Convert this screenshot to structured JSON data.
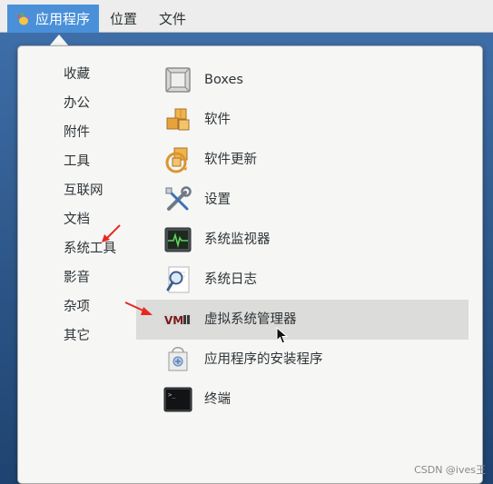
{
  "panel": {
    "applications_label": "应用程序",
    "places_label": "位置",
    "files_label": "文件"
  },
  "categories": [
    "收藏",
    "办公",
    "附件",
    "工具",
    "互联网",
    "文档",
    "系统工具",
    "影音",
    "杂项",
    "其它"
  ],
  "apps": [
    {
      "label": "Boxes",
      "icon": "boxes-icon"
    },
    {
      "label": "软件",
      "icon": "software-icon"
    },
    {
      "label": "软件更新",
      "icon": "software-update-icon"
    },
    {
      "label": "设置",
      "icon": "settings-icon"
    },
    {
      "label": "系统监视器",
      "icon": "system-monitor-icon"
    },
    {
      "label": "系统日志",
      "icon": "system-log-icon"
    },
    {
      "label": "虚拟系统管理器",
      "icon": "virt-manager-icon"
    },
    {
      "label": "应用程序的安装程序",
      "icon": "package-installer-icon"
    },
    {
      "label": "终端",
      "icon": "terminal-icon"
    }
  ],
  "hovered_app": "虚拟系统管理器",
  "annotations": {
    "arrow_color": "#e8281e"
  },
  "watermark": "CSDN @ives王"
}
